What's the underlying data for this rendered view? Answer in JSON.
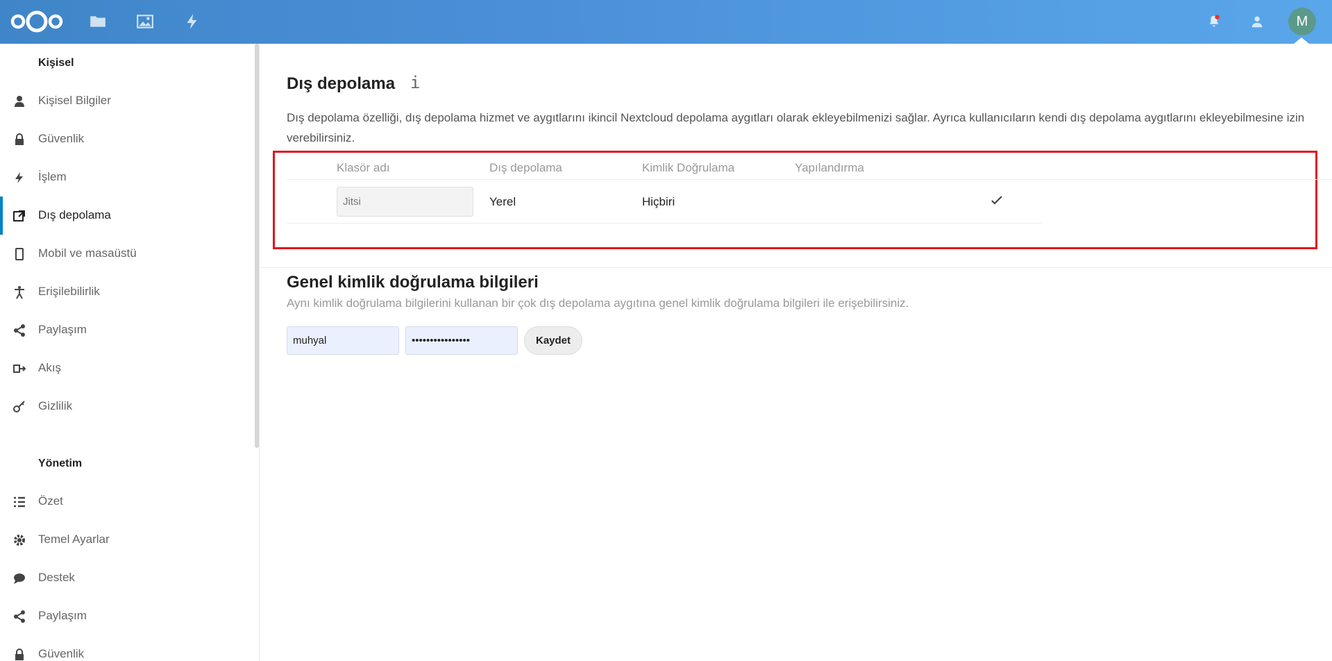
{
  "header": {
    "apps": [
      {
        "name": "files",
        "icon": "folder-icon"
      },
      {
        "name": "photos",
        "icon": "image-icon"
      },
      {
        "name": "activity",
        "icon": "lightning-icon"
      }
    ],
    "avatar_initial": "M",
    "notification_dot_color": "#e9322d"
  },
  "sidebar": {
    "section_personal": "Kişisel",
    "personal_items": [
      {
        "label": "Kişisel Bilgiler",
        "icon": "user-icon"
      },
      {
        "label": "Güvenlik",
        "icon": "lock-icon"
      },
      {
        "label": "İşlem",
        "icon": "lightning-icon"
      },
      {
        "label": "Dış depolama",
        "icon": "external-storage-icon",
        "active": true
      },
      {
        "label": "Mobil ve masaüstü",
        "icon": "phone-icon"
      },
      {
        "label": "Erişilebilirlik",
        "icon": "accessibility-icon"
      },
      {
        "label": "Paylaşım",
        "icon": "share-icon"
      },
      {
        "label": "Akış",
        "icon": "flow-icon"
      },
      {
        "label": "Gizlilik",
        "icon": "key-icon"
      }
    ],
    "section_admin": "Yönetim",
    "admin_items": [
      {
        "label": "Özet",
        "icon": "list-icon"
      },
      {
        "label": "Temel Ayarlar",
        "icon": "gear-icon"
      },
      {
        "label": "Destek",
        "icon": "chat-icon"
      },
      {
        "label": "Paylaşım",
        "icon": "share-icon"
      },
      {
        "label": "Güvenlik",
        "icon": "lock-icon"
      }
    ]
  },
  "main": {
    "title": "Dış depolama",
    "info_glyph": "i",
    "description": "Dış depolama özelliği, dış depolama hizmet ve aygıtlarını ikincil Nextcloud depolama aygıtları olarak ekleyebilmenizi sağlar. Ayrıca kullanıcıların kendi dış depolama aygıtlarını ekleyebilmesine izin verebilirsiniz.",
    "table": {
      "headers": [
        "Klasör adı",
        "Dış depolama",
        "Kimlik Doğrulama",
        "Yapılandırma"
      ],
      "row": {
        "folder_placeholder": "Jitsi",
        "storage": "Yerel",
        "auth": "Hiçbiri"
      }
    },
    "global_title": "Genel kimlik doğrulama bilgileri",
    "global_desc": "Aynı kimlik doğrulama bilgilerini kullanan bir çok dış depolama aygıtına genel kimlik doğrulama bilgileri ile erişebilirsiniz.",
    "username_value": "muhyal",
    "password_value": "••••••••••••••••",
    "save_label": "Kaydet"
  }
}
